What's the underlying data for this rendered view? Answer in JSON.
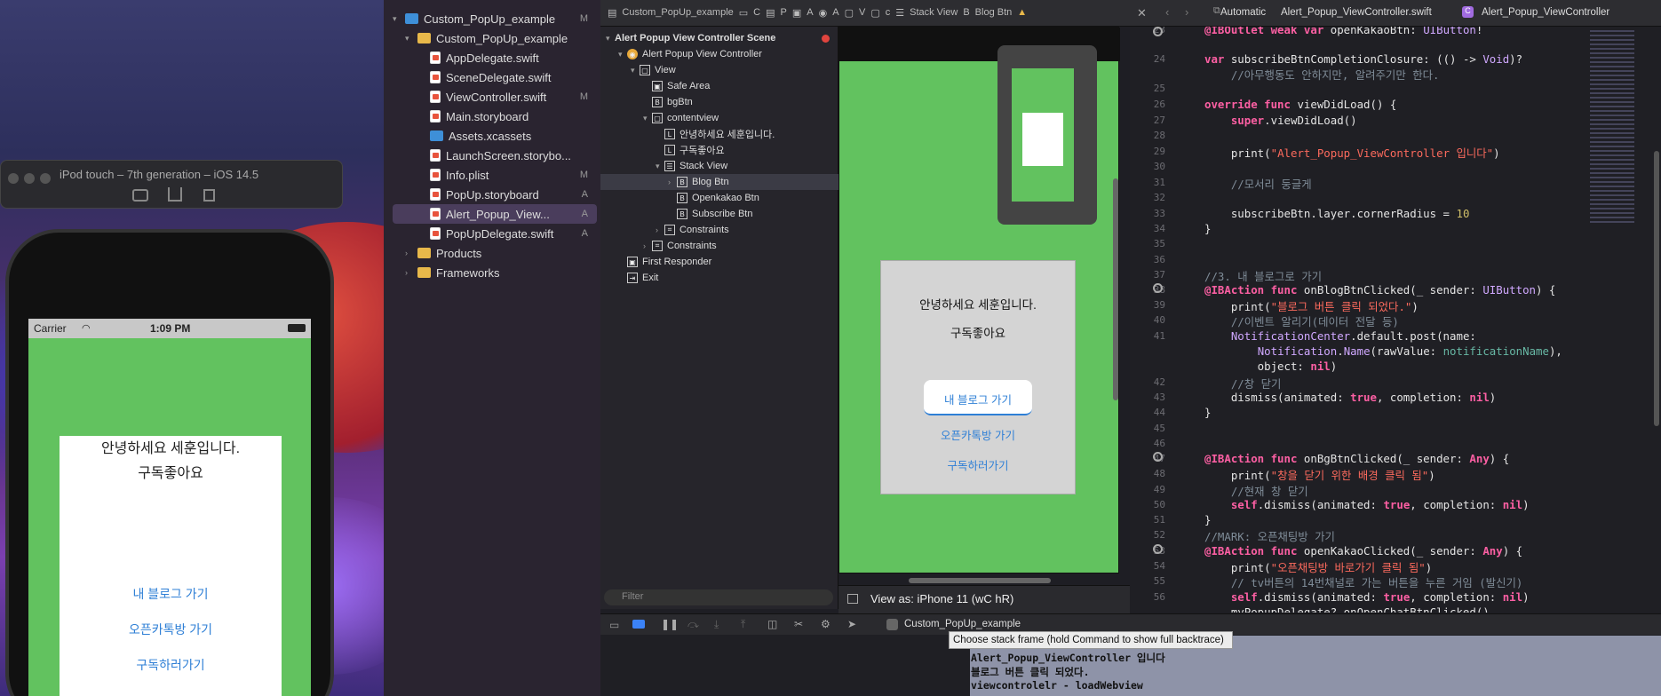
{
  "simulator": {
    "title": "iPod touch – 7th generation – iOS 14.5",
    "carrier": "Carrier",
    "time": "1:09 PM",
    "popup": {
      "greeting": "안녕하세요 세훈입니다.",
      "subtitle": "구독좋아요",
      "blog_button": "내 블로그 가기",
      "kakao_button": "오픈카톡방 가기",
      "subscribe_button": "구독하러가기"
    }
  },
  "navigator": {
    "items": [
      {
        "label": "Custom_PopUp_example",
        "badge": "M"
      },
      {
        "label": "Custom_PopUp_example",
        "badge": ""
      },
      {
        "label": "AppDelegate.swift",
        "badge": ""
      },
      {
        "label": "SceneDelegate.swift",
        "badge": ""
      },
      {
        "label": "ViewController.swift",
        "badge": "M"
      },
      {
        "label": "Main.storyboard",
        "badge": ""
      },
      {
        "label": "Assets.xcassets",
        "badge": ""
      },
      {
        "label": "LaunchScreen.storybo...",
        "badge": ""
      },
      {
        "label": "Info.plist",
        "badge": "M"
      },
      {
        "label": "PopUp.storyboard",
        "badge": "A"
      },
      {
        "label": "Alert_Popup_View...",
        "badge": "A"
      },
      {
        "label": "PopUpDelegate.swift",
        "badge": "A"
      },
      {
        "label": "Products",
        "badge": ""
      },
      {
        "label": "Frameworks",
        "badge": ""
      }
    ]
  },
  "ib_tabs": {
    "project": "Custom_PopUp_example",
    "p1": "C",
    "p2": "P",
    "p3": "A",
    "p4": "A",
    "p5": "V",
    "p6": "c",
    "stack": "Stack View",
    "blog": "Blog Btn"
  },
  "outline": {
    "items": [
      "Alert Popup View Controller Scene",
      "Alert Popup View Controller",
      "View",
      "Safe Area",
      "bgBtn",
      "contentview",
      "안녕하세요 세훈입니다.",
      "구독좋아요",
      "Stack View",
      "Blog Btn",
      "Openkakao Btn",
      "Subscribe Btn",
      "Constraints",
      "Constraints",
      "First Responder",
      "Exit"
    ],
    "filter_placeholder": "Filter"
  },
  "canvas": {
    "greeting": "안녕하세요 세훈입니다.",
    "subtitle": "구독좋아요",
    "blog_button": "내 블로그 가기",
    "kakao_button": "오픈카톡방 가기",
    "subscribe_button": "구독하러가기",
    "view_as": "View as: iPhone 11 (wC hR)"
  },
  "jump": {
    "mode": "Automatic",
    "file": "Alert_Popup_ViewController.swift",
    "symbol": "Alert_Popup_ViewController"
  },
  "debug": {
    "target": "Custom_PopUp_example",
    "tooltip": "Choose stack frame (hold Command to show full backtrace)",
    "console": [
      "Alert_Popup_ViewController 입니다",
      "블로그 버튼 클릭 되었다.",
      "viewcontrolelr - loadWebview"
    ]
  },
  "line_numbers": [
    "23",
    "24",
    "",
    "25",
    "26",
    "27",
    "28",
    "29",
    "30",
    "31",
    "32",
    "33",
    "34",
    "35",
    "36",
    "37",
    "38",
    "39",
    "40",
    "41",
    "",
    "",
    "42",
    "43",
    "44",
    "45",
    "46",
    "47",
    "48",
    "49",
    "50",
    "51",
    "52",
    "53",
    "54",
    "55",
    "56"
  ],
  "colors": {
    "green": "#62c25f",
    "button_blue": "#2e7fd6",
    "console_bg": "#8e93a8"
  }
}
